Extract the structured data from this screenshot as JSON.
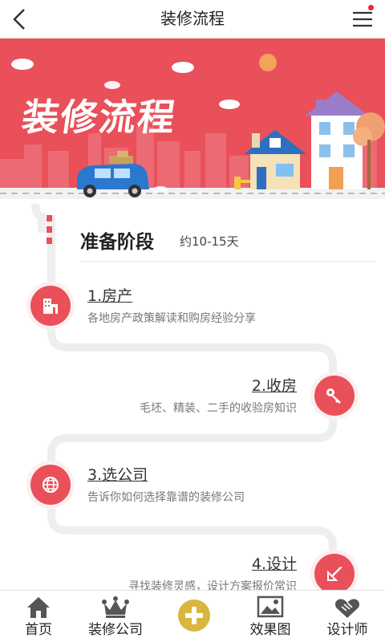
{
  "header": {
    "title": "装修流程"
  },
  "banner": {
    "title": "装修流程"
  },
  "stage": {
    "title": "准备阶段",
    "duration": "约10-15天"
  },
  "steps": [
    {
      "title": "1.房产",
      "desc": "各地房产政策解读和购房经验分享",
      "icon": "building-icon"
    },
    {
      "title": "2.收房",
      "desc": "毛坯、精装、二手的收验房知识",
      "icon": "key-icon"
    },
    {
      "title": "3.选公司",
      "desc": "告诉你如何选择靠谱的装修公司",
      "icon": "globe-icon"
    },
    {
      "title": "4.设计",
      "desc": "寻找装修灵感，设计方案报价常识",
      "icon": "design-icon"
    }
  ],
  "tabbar": {
    "items": [
      {
        "label": "首页",
        "icon": "home-icon"
      },
      {
        "label": "装修公司",
        "icon": "crown-icon"
      },
      {
        "label": "",
        "icon": "plus-icon"
      },
      {
        "label": "效果图",
        "icon": "picture-icon"
      },
      {
        "label": "设计师",
        "icon": "handshake-icon"
      }
    ]
  },
  "colors": {
    "accent": "#e9505a",
    "plus": "#d9b640"
  }
}
